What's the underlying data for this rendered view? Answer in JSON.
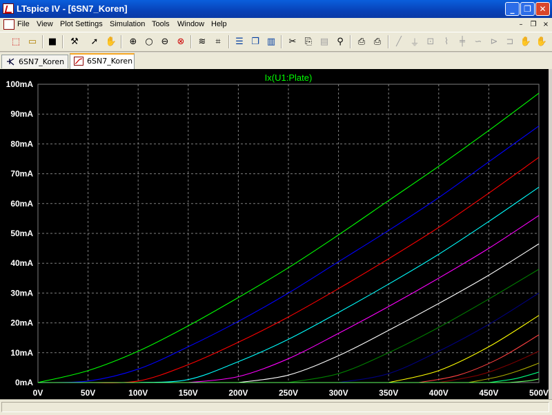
{
  "window": {
    "title": "LTspice IV - [6SN7_Koren]",
    "buttons": {
      "minimize": "_",
      "restore": "❐",
      "close": "✕"
    }
  },
  "menu": {
    "items": [
      "File",
      "View",
      "Plot Settings",
      "Simulation",
      "Tools",
      "Window",
      "Help"
    ],
    "doc_controls": {
      "minimize": "–",
      "restore": "❐",
      "close": "×"
    }
  },
  "toolbar": {
    "icons": [
      "new-schematic-icon",
      "open-icon",
      "save-icon",
      "control-panel-icon",
      "run-icon",
      "halt-icon",
      "zoom-in-icon",
      "zoom-area-icon",
      "zoom-out-icon",
      "zoom-cancel-icon",
      "autorange-icon",
      "zoom-full-icon",
      "tile-horizontal-icon",
      "cascade-icon",
      "tile-vertical-icon",
      "cut-icon",
      "copy-icon",
      "paste-icon",
      "find-icon",
      "print-preview-icon",
      "print-icon",
      "wire-icon",
      "ground-icon",
      "label-icon",
      "resistor-icon",
      "capacitor-icon",
      "inductor-icon",
      "diode-icon",
      "component-icon",
      "move-icon",
      "drag-icon"
    ]
  },
  "tabs": [
    {
      "label": "6SN7_Koren",
      "kind": "schematic-icon",
      "active": false
    },
    {
      "label": "6SN7_Koren",
      "kind": "waveform-icon",
      "active": true
    }
  ],
  "colors": {
    "plot_background": "#000000",
    "grid": "#808080",
    "axis_text": "#ffffff",
    "trace_title": "#00ff00"
  },
  "chart_data": {
    "type": "line",
    "title": "Ix(U1:Plate)",
    "xlabel": "",
    "ylabel": "",
    "xlim": [
      0,
      500
    ],
    "ylim": [
      0,
      100
    ],
    "x_ticks": [
      "0V",
      "50V",
      "100V",
      "150V",
      "200V",
      "250V",
      "300V",
      "350V",
      "400V",
      "450V",
      "500V"
    ],
    "y_ticks": [
      "0mA",
      "10mA",
      "20mA",
      "30mA",
      "40mA",
      "50mA",
      "60mA",
      "70mA",
      "80mA",
      "90mA",
      "100mA"
    ],
    "grid": true,
    "legend": "none",
    "series": [
      {
        "color": "#00ff00",
        "x": [
          0,
          50,
          100,
          150,
          200,
          250,
          300,
          350,
          400,
          450,
          500
        ],
        "y": [
          0,
          4,
          10.5,
          19,
          28.5,
          38.5,
          49.5,
          61,
          72.5,
          84.5,
          97
        ]
      },
      {
        "color": "#0000ff",
        "x": [
          0,
          50,
          100,
          150,
          200,
          250,
          300,
          350,
          400,
          450,
          500
        ],
        "y": [
          0,
          0.5,
          4.5,
          12,
          20.5,
          30,
          40.5,
          51,
          62,
          74,
          86
        ]
      },
      {
        "color": "#ff0000",
        "x": [
          50,
          100,
          150,
          200,
          250,
          300,
          350,
          400,
          450,
          500
        ],
        "y": [
          0,
          0.5,
          6,
          13.5,
          22,
          31.5,
          41.5,
          52,
          63.5,
          75.5
        ]
      },
      {
        "color": "#00ffff",
        "x": [
          100,
          150,
          200,
          250,
          300,
          350,
          400,
          450,
          500
        ],
        "y": [
          0,
          1,
          7,
          14.5,
          23.5,
          33,
          43,
          54,
          65.5
        ]
      },
      {
        "color": "#ff00ff",
        "x": [
          150,
          200,
          250,
          300,
          350,
          400,
          450,
          500
        ],
        "y": [
          0,
          2,
          8,
          16.5,
          25.5,
          35,
          45,
          56
        ]
      },
      {
        "color": "#ffffff",
        "x": [
          200,
          250,
          300,
          350,
          400,
          450,
          500
        ],
        "y": [
          0,
          2.5,
          9,
          17.5,
          26.5,
          36,
          46.5
        ]
      },
      {
        "color": "#008000",
        "x": [
          250,
          300,
          350,
          400,
          450,
          500
        ],
        "y": [
          0,
          3,
          10,
          18.5,
          28,
          38
        ]
      },
      {
        "color": "#000080",
        "x": [
          300,
          350,
          400,
          450,
          500
        ],
        "y": [
          0,
          3,
          10.5,
          19.5,
          30
        ]
      },
      {
        "color": "#ffff00",
        "x": [
          350,
          400,
          450,
          500
        ],
        "y": [
          0,
          4,
          12,
          22.5
        ]
      },
      {
        "color": "#ff4040",
        "x": [
          380,
          420,
          460,
          500
        ],
        "y": [
          0,
          2.5,
          8,
          16
        ]
      },
      {
        "color": "#800000",
        "x": [
          400,
          440,
          470,
          500
        ],
        "y": [
          0,
          2.5,
          6,
          10.5
        ]
      },
      {
        "color": "#aaaa00",
        "x": [
          430,
          460,
          480,
          500
        ],
        "y": [
          0,
          2,
          4,
          6.5
        ]
      },
      {
        "color": "#00ff80",
        "x": [
          450,
          475,
          490,
          500
        ],
        "y": [
          0,
          1.2,
          2.5,
          3.5
        ]
      },
      {
        "color": "#60ff60",
        "x": [
          470,
          490,
          500
        ],
        "y": [
          0,
          0.6,
          1.2
        ]
      }
    ]
  }
}
